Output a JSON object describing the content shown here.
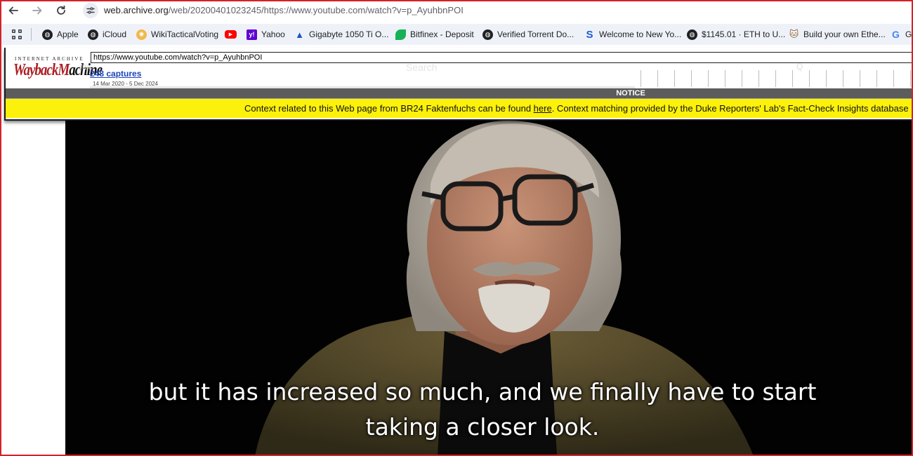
{
  "browser": {
    "url_host": "web.archive.org",
    "url_path": "/web/20200401023245/https://www.youtube.com/watch?v=p_AyuhbnPOI"
  },
  "bookmarks": [
    {
      "label": "Apple",
      "icon": "globe-icon",
      "color": "#202124"
    },
    {
      "label": "iCloud",
      "icon": "globe-icon",
      "color": "#202124"
    },
    {
      "label": "WikiTacticalVoting",
      "icon": "sun-icon",
      "color": "#f2b84b"
    },
    {
      "label": "",
      "icon": "youtube-icon",
      "color": "#ff0000"
    },
    {
      "label": "Yahoo",
      "icon": "yahoo-icon",
      "color": "#5f01d1"
    },
    {
      "label": "Gigabyte 1050 Ti O...",
      "icon": "gigabyte-icon",
      "color": "#1a56c4"
    },
    {
      "label": "Bitfinex - Deposit",
      "icon": "leaf-icon",
      "color": "#16b157"
    },
    {
      "label": "Verified Torrent Do...",
      "icon": "globe-icon",
      "color": "#202124"
    },
    {
      "label": "Welcome to New Yo...",
      "icon": "s-icon",
      "color": "#1c5bd6"
    },
    {
      "label": "$1145.01 · ETH to U...",
      "icon": "globe-icon",
      "color": "#202124"
    },
    {
      "label": "Build your own Ethe...",
      "icon": "cat-icon",
      "color": "#9a6b3f"
    },
    {
      "label": "G",
      "icon": "google-icon",
      "color": "#4285f4"
    }
  ],
  "wayback": {
    "logo_top": "INTERNET ARCHIVE",
    "logo_main_a": "WaybackM",
    "logo_main_b": "achine",
    "url_value": "https://www.youtube.com/watch?v=p_AyuhbnPOI",
    "captures": "248 captures",
    "range": "14 Mar 2020 - 5 Dec 2024",
    "ghost_search": "Search",
    "notice": "NOTICE",
    "context_before": "Context related to this Web page from BR24 Faktenfuchs can be found ",
    "context_link": "here",
    "context_after": ". Context matching provided by the Duke Reporters' Lab's Fact-Check Insights database"
  },
  "video": {
    "caption_line1": "but it has increased so much, and we finally have to start",
    "caption_line2": "taking a closer look."
  }
}
